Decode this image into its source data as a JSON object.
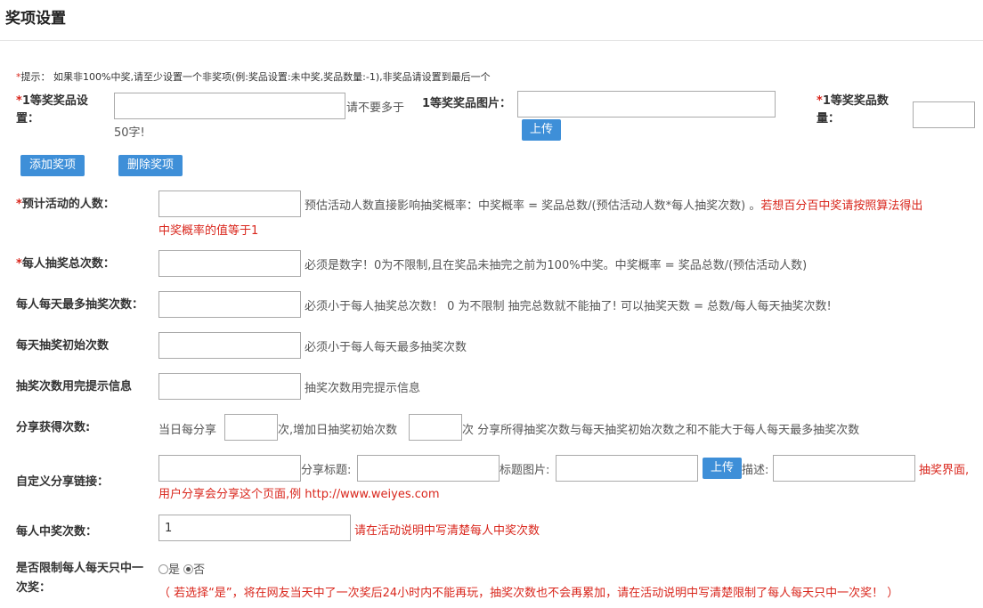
{
  "page": {
    "title": "奖项设置"
  },
  "tip": {
    "prefix": "*",
    "text": "提示： 如果非100%中奖,请至少设置一个非奖项(例:奖品设置:未中奖,奖品数量:-1),非奖品请设置到最后一个"
  },
  "prize": {
    "name_label": "1等奖奖品设置：",
    "name_hint_line1": "请不要多于",
    "name_hint_line2": "50字!",
    "image_label": "1等奖奖品图片：",
    "upload_label": "上传",
    "qty_label_line1": "1等奖奖品数",
    "qty_label_line2": "量："
  },
  "buttons": {
    "add": "添加奖项",
    "remove": "删除奖项"
  },
  "fields": {
    "participants": {
      "label": "预计活动的人数：",
      "hint": "预估活动人数直接影响抽奖概率：中奖概率 = 奖品总数/(预估活动人数*每人抽奖次数) 。",
      "hint_red_1": "若想百分百中奖请按照算法得出",
      "hint_red_2": "中奖概率的值等于1"
    },
    "total_draws": {
      "label": "每人抽奖总次数：",
      "hint": "必须是数字！0为不限制,且在奖品未抽完之前为100%中奖。中奖概率 = 奖品总数/(预估活动人数)"
    },
    "daily_max": {
      "label": "每人每天最多抽奖次数：",
      "hint": "必须小于每人抽奖总次数！ 0 为不限制 抽完总数就不能抽了! 可以抽奖天数 = 总数/每人每天抽奖次数!"
    },
    "daily_initial": {
      "label": "每天抽奖初始次数",
      "hint": "必须小于每人每天最多抽奖次数"
    },
    "exhausted_msg": {
      "label": "抽奖次数用完提示信息",
      "placeholder": "抽奖次数用完提示信息"
    },
    "share_draws": {
      "label": "分享获得次数:",
      "text1": "当日每分享",
      "text2": "次,增加日抽奖初始次数",
      "text3": "次 分享所得抽奖次数与每天抽奖初始次数之和不能大于每人每天最多抽奖次数"
    },
    "share_link": {
      "label": "自定义分享链接：",
      "title_label": "分享标题:",
      "image_label": "标题图片:",
      "upload_label": "上传",
      "desc_label": "描述:",
      "red_1": "抽奖界面,",
      "red_2": "用户分享会分享这个页面,例 http://www.weiyes.com"
    },
    "wins_per_user": {
      "label": "每人中奖次数：",
      "value": "1",
      "hint": "请在活动说明中写清楚每人中奖次数"
    },
    "daily_limit": {
      "label_line1": "是否限制每人每天只中一",
      "label_line2": "次奖：",
      "option_yes": "是",
      "option_no": "否",
      "selected": "否",
      "note": "（ 若选择“是”，将在网友当天中了一次奖后24小时内不能再玩，抽奖次数也不会再累加，请在活动说明中写清楚限制了每人每天只中一次奖！ ）"
    }
  },
  "colors": {
    "accent": "#3e8fd8",
    "required": "#d9261c"
  }
}
